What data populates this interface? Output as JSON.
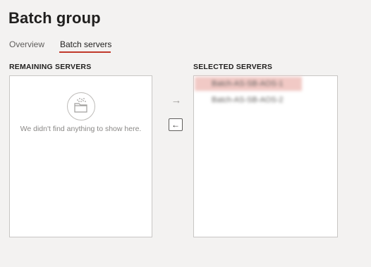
{
  "page": {
    "title": "Batch group"
  },
  "tabs": [
    {
      "label": "Overview",
      "active": false
    },
    {
      "label": "Batch servers",
      "active": true
    }
  ],
  "remaining": {
    "label": "REMAINING SERVERS",
    "empty_text": "We didn't find anything to show here.",
    "empty_icon": "folder-icon"
  },
  "selected": {
    "label": "SELECTED SERVERS",
    "items": [
      {
        "label": "Batch-AS-SB-AOS-1",
        "highlighted": true
      },
      {
        "label": "Batch-AS-SB-AOS-2",
        "highlighted": false
      }
    ]
  },
  "controls": {
    "move_right_icon": "arrow-right-icon",
    "move_left_icon": "arrow-left-icon"
  },
  "colors": {
    "accent": "#c0392b",
    "selected_highlight": "#f1c9c5",
    "background": "#f3f2f1"
  }
}
